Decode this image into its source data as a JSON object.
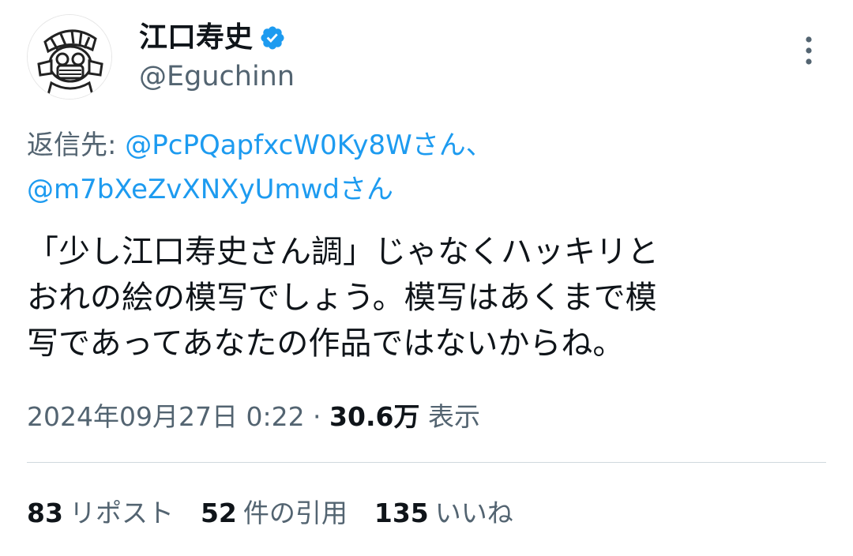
{
  "author": {
    "display_name": "江口寿史",
    "handle": "@Eguchinn",
    "verified": true,
    "avatar_icon": "avatar-illustration"
  },
  "reply": {
    "prefix": "返信先: ",
    "first_user": "@PcPQapfxcW0Ky8Wさん",
    "separator": "、",
    "second_user": "@m7bXeZvXNXyUmwdさん"
  },
  "tweet": {
    "lines": [
      "「少し江口寿史さん調」じゃなくハッキリと",
      "おれの絵の模写でしょう。模写はあくまで模",
      "写であってあなたの作品ではないからね。"
    ]
  },
  "meta": {
    "timestamp": "2024年09月27日 0:22",
    "dot": " · ",
    "views_count": "30.6万",
    "views_label": " 表示"
  },
  "stats": {
    "reposts_count": "83",
    "reposts_label": "リポスト",
    "quotes_count": "52",
    "quotes_label": "件の引用",
    "likes_count": "135",
    "likes_label": "いいね"
  },
  "colors": {
    "link": "#1d9bf0",
    "secondary_text": "#536471",
    "primary_text": "#0f1419",
    "divider": "#cfd9de",
    "verified_badge": "#1d9bf0"
  },
  "icons": {
    "verified": "verified-badge-icon",
    "more": "more-options-icon"
  }
}
